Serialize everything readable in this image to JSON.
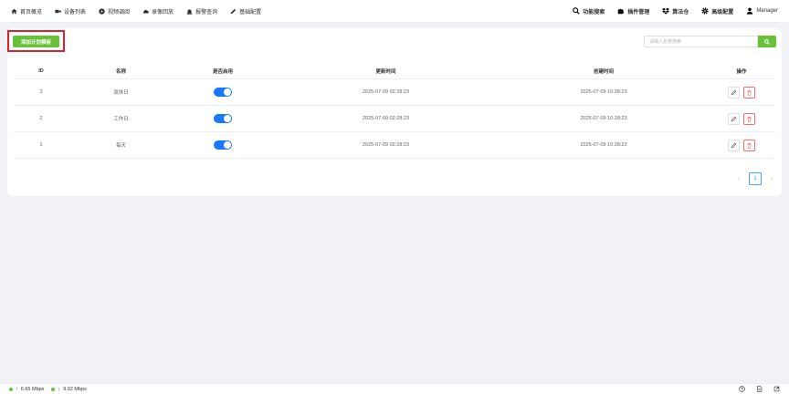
{
  "nav": {
    "left": [
      {
        "label": "首页概览",
        "icon": "home-icon"
      },
      {
        "label": "设备列表",
        "icon": "video-camera-icon"
      },
      {
        "label": "视频调阅",
        "icon": "play-circle-icon"
      },
      {
        "label": "录像回放",
        "icon": "cloud-icon"
      },
      {
        "label": "报警查询",
        "icon": "alarm-icon"
      },
      {
        "label": "基础配置",
        "icon": "edit-icon"
      }
    ],
    "right": [
      {
        "label": "功能搜索",
        "icon": "search-icon"
      },
      {
        "label": "插件管理",
        "icon": "puzzle-icon"
      },
      {
        "label": "算法仓",
        "icon": "dropbox-icon"
      },
      {
        "label": "高级配置",
        "icon": "gear-icon"
      },
      {
        "label": "Manager",
        "icon": "user-icon"
      }
    ]
  },
  "toolbar": {
    "add_label": "添加计划模板",
    "search_placeholder": "请输入名称搜索"
  },
  "table": {
    "headers": {
      "id": "ID",
      "name": "名称",
      "enabled": "是否启用",
      "updated": "更新时间",
      "created": "创建时间",
      "ops": "操作"
    },
    "rows": [
      {
        "id": "3",
        "name": "双休日",
        "enabled": true,
        "updated": "2025-07-09 02:28:23",
        "created": "2025-07-09 10:28:23"
      },
      {
        "id": "2",
        "name": "工作日",
        "enabled": true,
        "updated": "2025-07-09 02:28:23",
        "created": "2025-07-09 10:28:23"
      },
      {
        "id": "1",
        "name": "每天",
        "enabled": true,
        "updated": "2025-07-09 02:28:23",
        "created": "2025-07-09 10:28:23"
      }
    ]
  },
  "pagination": {
    "prev": "‹",
    "current": "1",
    "next": "›"
  },
  "status": {
    "upload": "6.65 Mbps",
    "download": "9.92 Mbps"
  },
  "colors": {
    "accent_green": "#67c23a",
    "switch_blue": "#1677ff",
    "danger": "#f56c6c",
    "highlight_red": "#e0202a"
  }
}
